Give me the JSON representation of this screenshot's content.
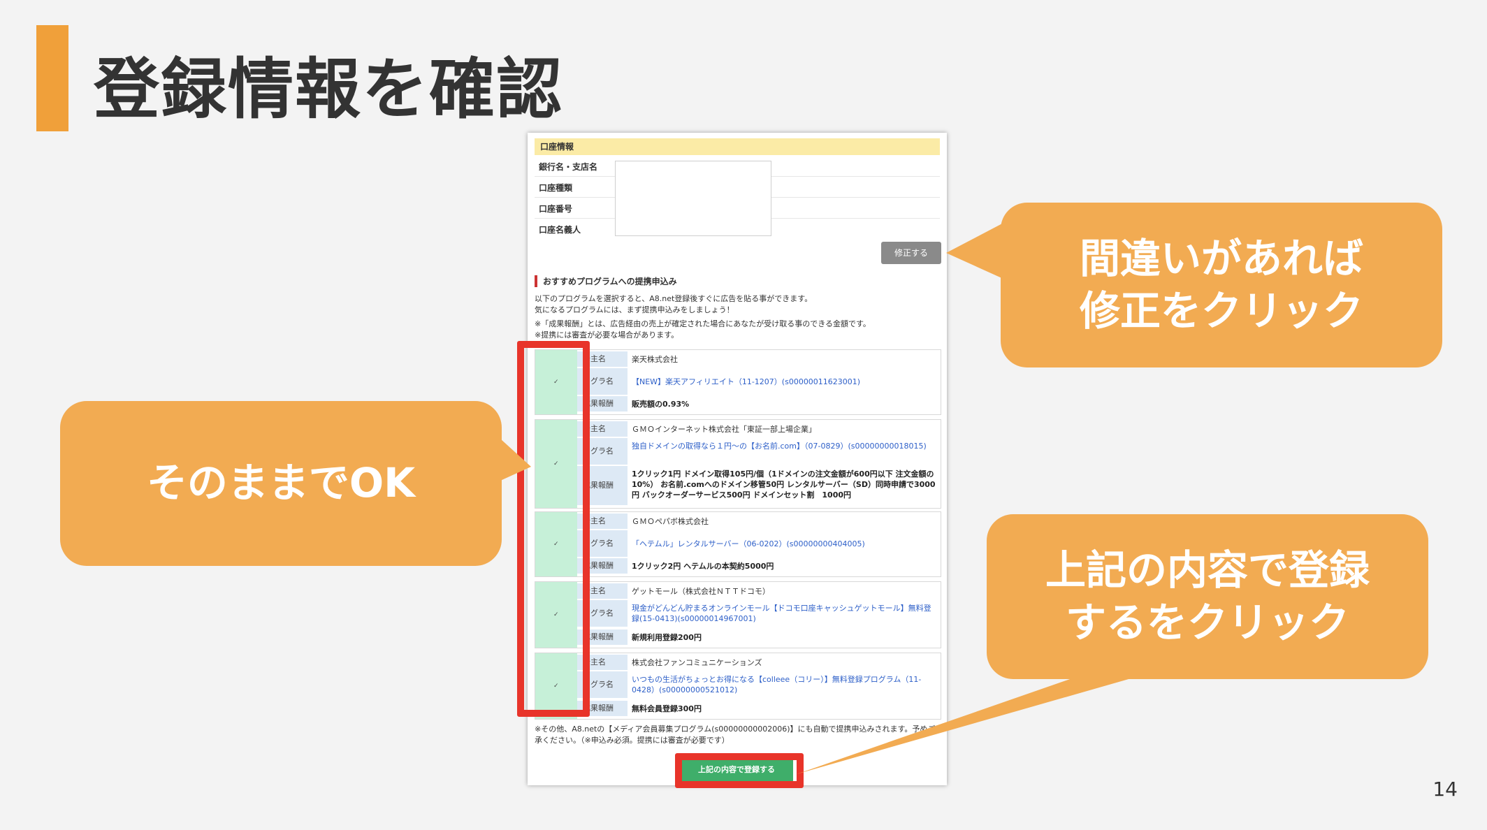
{
  "slide": {
    "title": "登録情報を確認",
    "page_number": "14"
  },
  "account": {
    "header": "口座情報",
    "rows": [
      "銀行名・支店名",
      "口座種類",
      "口座番号",
      "口座名義人"
    ],
    "edit_button": "修正する"
  },
  "recommend": {
    "header": "おすすめプログラムへの提携申込み",
    "intro": [
      "以下のプログラムを選択すると、A8.net登録後すぐに広告を貼る事ができます。",
      "気になるプログラムには、まず提携申込みをしましょう！",
      "※「成果報酬」とは、広告経由の売上が確定された場合にあなたが受け取る事のできる金額です。",
      "※提携には審査が必要な場合があります。"
    ],
    "labels": {
      "advertiser": "告主名",
      "program": "ログラ名",
      "reward": "成果報酬"
    },
    "programs": [
      {
        "advertiser": "楽天株式会社",
        "program": "【NEW】楽天アフィリエイト（11-1207）(s00000011623001)",
        "reward": "販売額の0.93%"
      },
      {
        "advertiser": "ＧＭＯインターネット株式会社「東証一部上場企業」",
        "program": "独自ドメインの取得なら１円〜の【お名前.com】（07-0829）(s00000000018015)",
        "reward": "1クリック1円 ドメイン取得105円/個（1ドメインの注文金額が600円以下 注文金額の10%） お名前.comへのドメイン移管50円 レンタルサーバー（SD）同時申請で3000円 バックオーダーサービス500円 ドメインセット割　1000円"
      },
      {
        "advertiser": "ＧＭＯペパボ株式会社",
        "program": "「ヘテムル」レンタルサーバー（06-0202）(s00000000404005)",
        "reward": "1クリック2円 ヘテムルの本契約5000円"
      },
      {
        "advertiser": "ゲットモール（株式会社ＮＴＴドコモ）",
        "program": "現金がどんどん貯まるオンラインモール【ドコモ口座キャッシュゲットモール】無料登録(15-0413)(s00000014967001)",
        "reward": "新規利用登録200円"
      },
      {
        "advertiser": "株式会社ファンコミュニケーションズ",
        "program": "いつもの生活がちょっとお得になる【colleee（コリー）】無料登録プログラム（11-0428）(s00000000521012)",
        "reward": "無料会員登録300円"
      }
    ],
    "footer": "※その他、A8.netの【メディア会員募集プログラム(s00000000002006)】にも自動で提携申込みされます。予めご了承ください。（※申込み必須。提携には審査が必要です）",
    "submit_button": "上記の内容で登録する"
  },
  "callouts": {
    "fix": "間違いがあれば\n修正をクリック",
    "ok": "そのままでOK",
    "register": "上記の内容で登録\nするをクリック"
  },
  "colors": {
    "accent": "#f0a03a",
    "callout": "#f2ab52",
    "highlight": "#e8342a",
    "check_bg": "#c6f0d8",
    "submit": "#3fae6a"
  }
}
